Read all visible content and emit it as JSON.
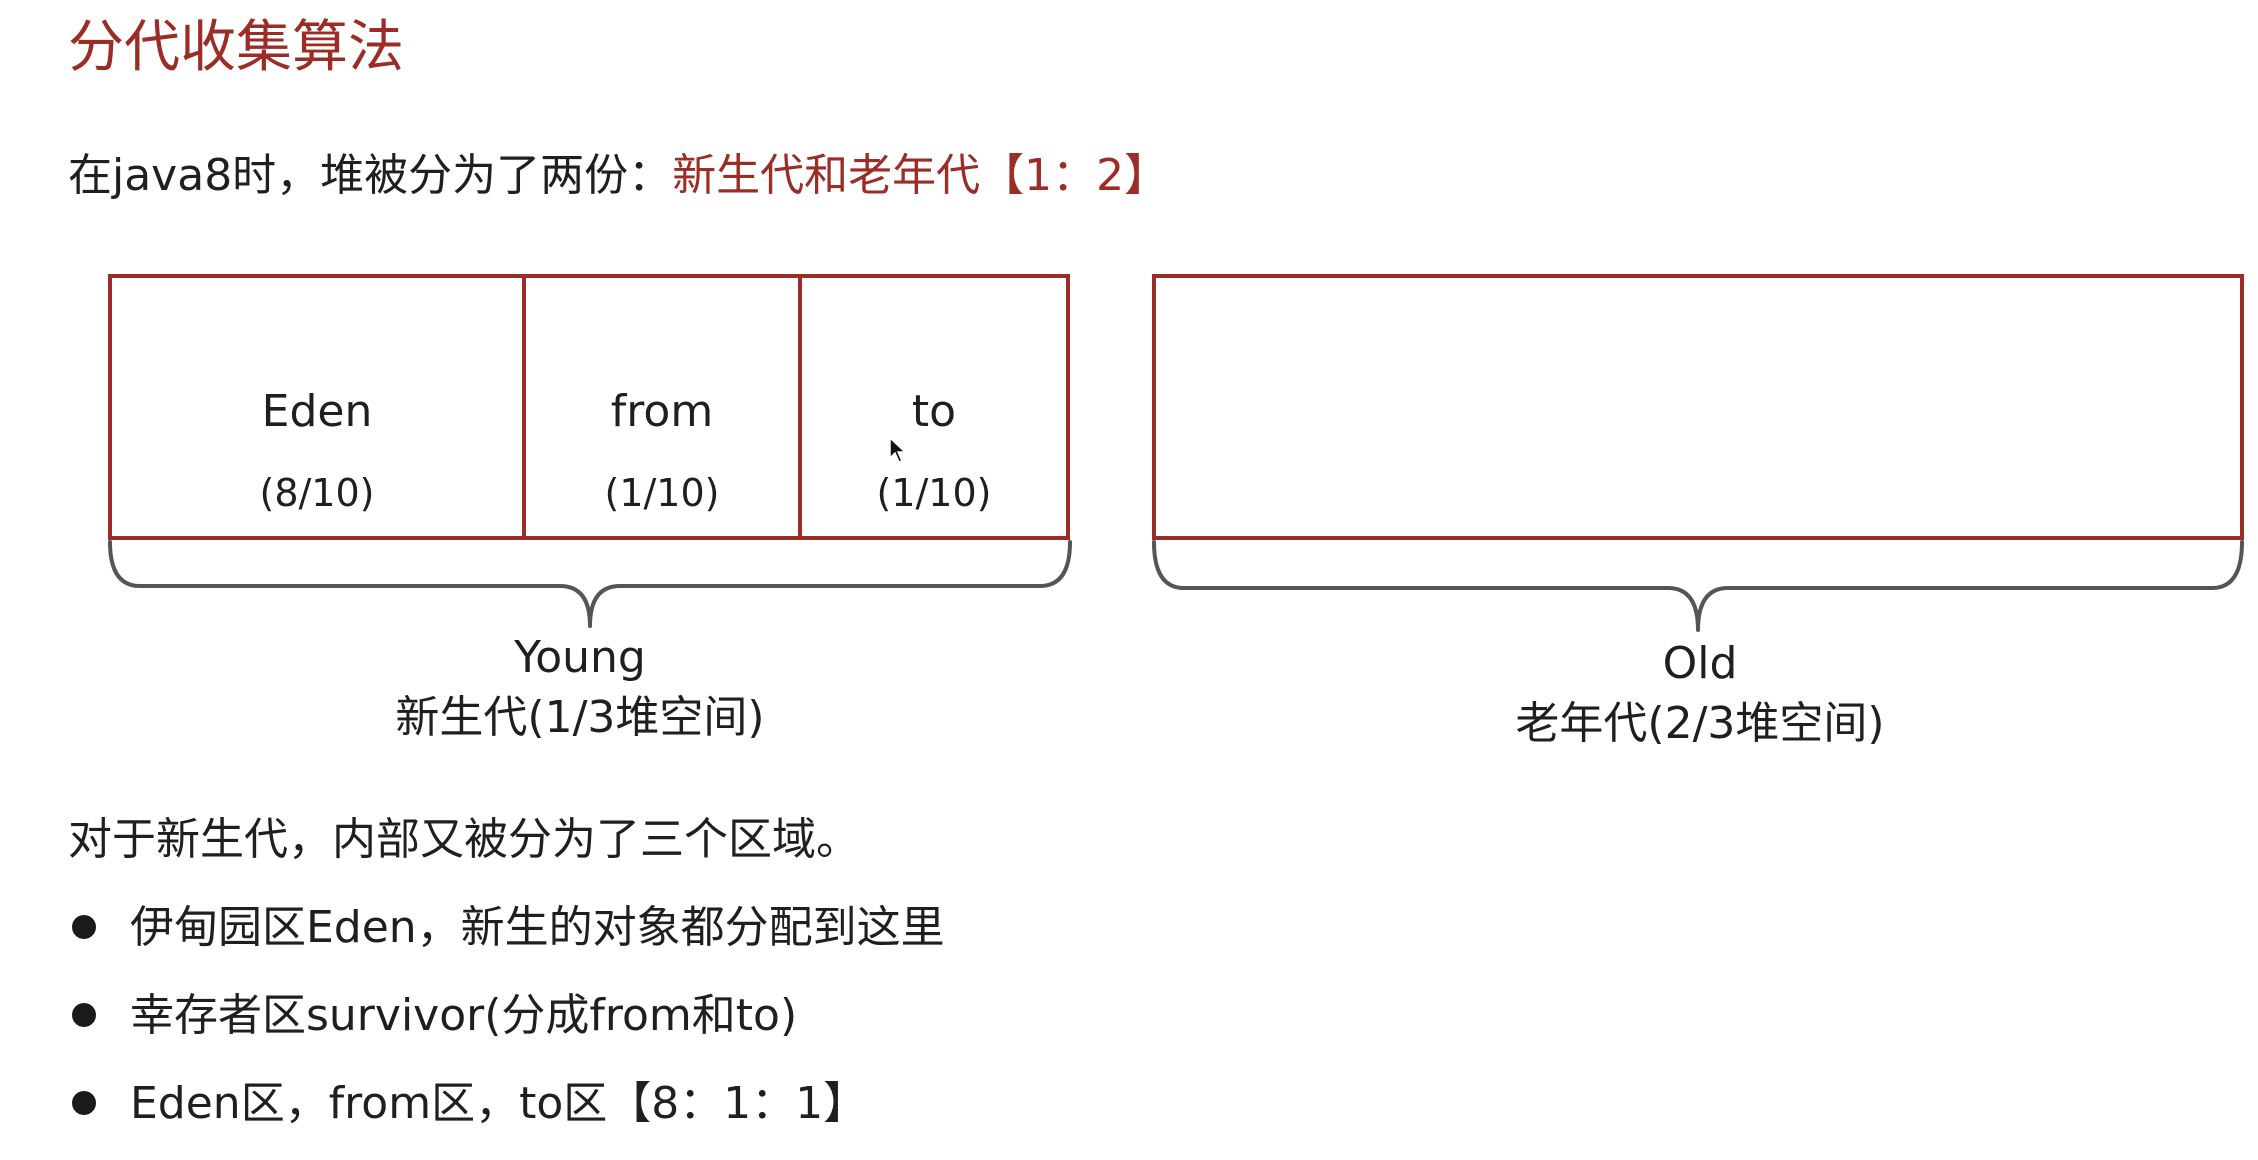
{
  "title": "分代收集算法",
  "intro": {
    "prefix": "在java8时，堆被分为了两份：",
    "highlight": "新生代和老年代【1：2】"
  },
  "colors": {
    "accent": "#9b2c26",
    "text": "#1f1f1f",
    "brace": "#555555"
  },
  "young_regions": [
    {
      "name": "Eden",
      "ratio": "(8/10)"
    },
    {
      "name": "from",
      "ratio": "(1/10)"
    },
    {
      "name": "to",
      "ratio": "(1/10)"
    }
  ],
  "young": {
    "name": "Young",
    "desc": "新生代(1/3堆空间)"
  },
  "old": {
    "name": "Old",
    "desc": "老年代(2/3堆空间)"
  },
  "paragraph": "对于新生代，内部又被分为了三个区域。",
  "bullets": [
    "伊甸园区Eden，新生的对象都分配到这里",
    "幸存者区survivor(分成from和to)",
    "Eden区，from区，to区【8：1：1】"
  ],
  "icons": {
    "cursor": "mouse-pointer-icon",
    "bullet": "bullet-dot-icon"
  }
}
